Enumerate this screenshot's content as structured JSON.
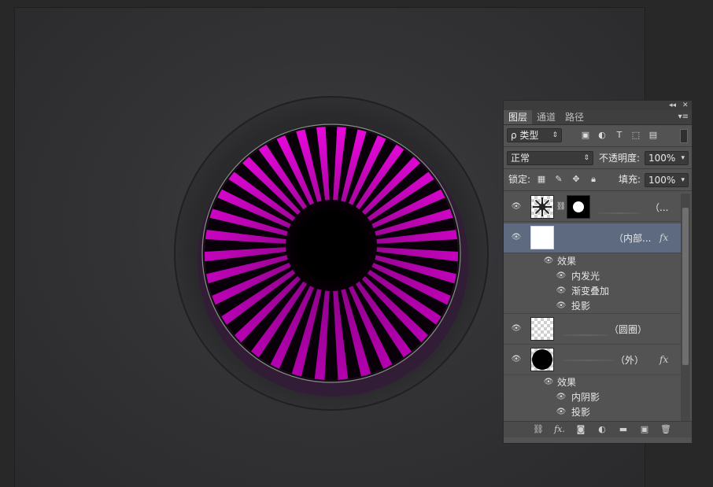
{
  "panel": {
    "collapse_icon": "double-chevron-left-icon",
    "close_icon": "close-icon",
    "tabs": [
      {
        "label": "图层",
        "active": true
      },
      {
        "label": "通道",
        "active": false
      },
      {
        "label": "路径",
        "active": false
      }
    ],
    "filter": {
      "label": "ρ 类型"
    },
    "blend_mode": "正常",
    "opacity_label": "不透明度:",
    "opacity_value": "100%",
    "lock_label": "锁定:",
    "fill_label": "填充:",
    "fill_value": "100%",
    "layers": [
      {
        "name": "（...",
        "has_mask": true,
        "selected": false
      },
      {
        "name": "（内部...",
        "fx": "fx",
        "selected": true,
        "effects_title": "效果",
        "effects": [
          "内发光",
          "渐变叠加",
          "投影"
        ]
      },
      {
        "name": "（圆圈）",
        "selected": false
      },
      {
        "name": "（外）",
        "fx": "fx",
        "selected": false,
        "effects_title": "效果",
        "effects": [
          "内阴影",
          "投影"
        ]
      }
    ]
  },
  "colors": {
    "accent_magenta": "#e000d8",
    "panel_bg": "#535353",
    "selection": "#5d6a7f"
  }
}
